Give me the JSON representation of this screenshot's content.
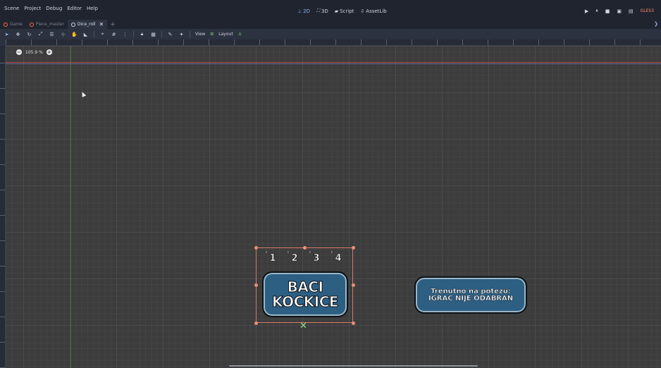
{
  "menu": [
    "Scene",
    "Project",
    "Debug",
    "Editor",
    "Help"
  ],
  "modes": [
    {
      "icon": "2d-icon",
      "glyph": "⊥",
      "label": "2D",
      "active": true
    },
    {
      "icon": "3d-icon",
      "glyph": "⛶",
      "label": "3D",
      "active": false
    },
    {
      "icon": "script-icon",
      "glyph": "▰",
      "label": "Script",
      "active": false
    },
    {
      "icon": "assetlib-icon",
      "glyph": "⇩",
      "label": "AssetLib",
      "active": false
    }
  ],
  "play_controls": {
    "play": "▶",
    "pause": "⏸",
    "stop": "■",
    "play_scene": "▣",
    "play_custom": "▤",
    "renderer": "GLES3"
  },
  "tabs": [
    {
      "label": "Game",
      "active": false
    },
    {
      "label": "Piece_master",
      "active": false
    },
    {
      "label": "Dice_roll",
      "active": true
    }
  ],
  "toolbar": {
    "view_label": "View",
    "layout_label": "Layout"
  },
  "zoom": {
    "minus": "−",
    "level": "105.9 %",
    "plus": "+"
  },
  "dice": [
    {
      "pip": "⠃",
      "value": "1"
    },
    {
      "pip": "⠃",
      "value": "2"
    },
    {
      "pip": "⠃",
      "value": "3"
    },
    {
      "pip": "⠃",
      "value": "4"
    }
  ],
  "roll_button": {
    "line1": "BACI",
    "line2": "KOCKICE"
  },
  "status_label": {
    "line1": "Trenutno na potezu:",
    "line2": "IGRAC NIJE ODABRAN"
  }
}
